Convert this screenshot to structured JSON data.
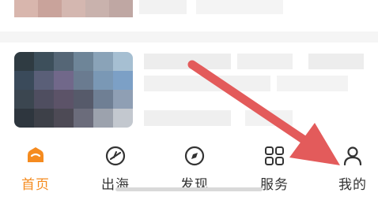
{
  "colors": {
    "accent": "#f58b1f",
    "arrow": "#e35b5b",
    "text": "#333333"
  },
  "tabs": [
    {
      "label": "首页",
      "icon": "home-icon",
      "active": true
    },
    {
      "label": "出海",
      "icon": "compass-sail-icon",
      "active": false
    },
    {
      "label": "发现",
      "icon": "discover-compass-icon",
      "active": false
    },
    {
      "label": "服务",
      "icon": "grid-services-icon",
      "active": false
    },
    {
      "label": "我的",
      "icon": "profile-icon",
      "active": false
    }
  ]
}
